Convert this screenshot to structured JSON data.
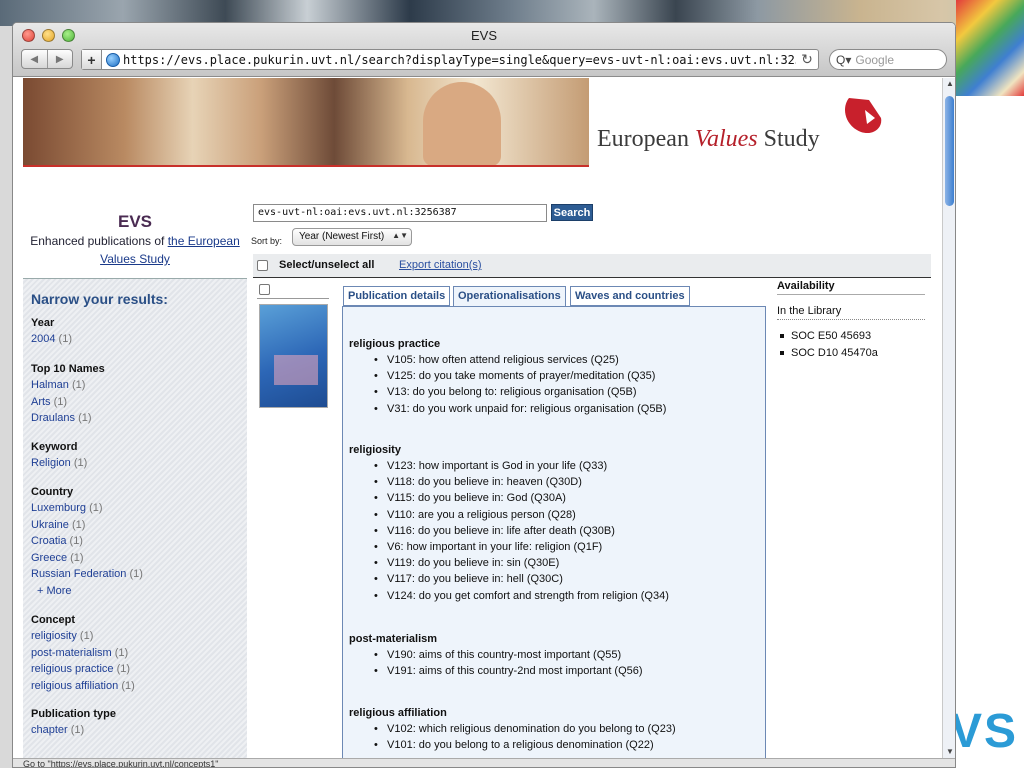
{
  "window": {
    "title": "EVS"
  },
  "toolbar": {
    "back_icon": "chevron-left",
    "forward_icon": "chevron-right",
    "add_icon": "plus",
    "url": "https://evs.place.pukurin.uvt.nl/search?displayType=single&query=evs-uvt-nl:oai:evs.uvt.nl:3256387",
    "reload_icon": "reload",
    "search_placeholder": "Google"
  },
  "header": {
    "brand_part1": "European ",
    "brand_accent": "Values",
    "brand_part2": " Study"
  },
  "site": {
    "title": "EVS",
    "subtitle_prefix": "Enhanced publications of ",
    "subtitle_link": "the European Values Study"
  },
  "search": {
    "query": "evs-uvt-nl:oai:evs.uvt.nl:3256387",
    "button": "Search",
    "sort_label": "Sort by:",
    "sort_value": "Year (Newest First)",
    "select_all": "Select/unselect all",
    "export": "Export citation(s)"
  },
  "sidebar": {
    "title": "Narrow your results:",
    "facets": [
      {
        "heading": "Year",
        "items": [
          {
            "label": "2004",
            "count": "(1)"
          }
        ]
      },
      {
        "heading": "Top 10 Names",
        "items": [
          {
            "label": "Halman",
            "count": "(1)"
          },
          {
            "label": "Arts",
            "count": "(1)"
          },
          {
            "label": "Draulans",
            "count": "(1)"
          }
        ]
      },
      {
        "heading": "Keyword",
        "items": [
          {
            "label": "Religion",
            "count": "(1)"
          }
        ]
      },
      {
        "heading": "Country",
        "items": [
          {
            "label": "Luxemburg",
            "count": "(1)"
          },
          {
            "label": "Ukraine",
            "count": "(1)"
          },
          {
            "label": "Croatia",
            "count": "(1)"
          },
          {
            "label": "Greece",
            "count": "(1)"
          },
          {
            "label": "Russian Federation",
            "count": "(1)"
          }
        ],
        "more": "+ More"
      },
      {
        "heading": "Concept",
        "items": [
          {
            "label": "religiosity",
            "count": "(1)"
          },
          {
            "label": "post-materialism",
            "count": "(1)"
          },
          {
            "label": "religious practice",
            "count": "(1)"
          },
          {
            "label": "religious affiliation",
            "count": "(1)"
          }
        ]
      },
      {
        "heading": "Publication type",
        "items": [
          {
            "label": "chapter",
            "count": "(1)"
          }
        ]
      }
    ]
  },
  "result": {
    "tabs": [
      "Publication details",
      "Operationalisations",
      "Waves and countries"
    ],
    "active_tab": "Operationalisations",
    "groups": [
      {
        "heading": "religious practice",
        "items": [
          "V105: how often attend religious services (Q25)",
          "V125: do you take moments of prayer/meditation (Q35)",
          "V13: do you belong to: religious organisation (Q5B)",
          "V31: do you work unpaid for: religious organisation (Q5B)"
        ]
      },
      {
        "heading": "religiosity",
        "items": [
          "V123: how important is God in your life (Q33)",
          "V118: do you believe in: heaven (Q30D)",
          "V115: do you believe in: God (Q30A)",
          "V110: are you a religious person (Q28)",
          "V116: do you believe in: life after death (Q30B)",
          "V6: how important in your life: religion (Q1F)",
          "V119: do you believe in: sin (Q30E)",
          "V117: do you believe in: hell (Q30C)",
          "V124: do you get comfort and strength from religion (Q34)"
        ]
      },
      {
        "heading": "post-materialism",
        "items": [
          "V190: aims of this country-most important (Q55)",
          "V191: aims of this country-2nd most important (Q56)"
        ]
      },
      {
        "heading": "religious affiliation",
        "items": [
          "V102: which religious denomination do you belong to (Q23)",
          "V101: do you belong to a religious denomination (Q22)"
        ]
      }
    ]
  },
  "availability": {
    "heading": "Availability",
    "subheading": "In the Library",
    "items": [
      "SOC E50 45693",
      "SOC D10 45470a"
    ]
  },
  "statusbar": {
    "text": "Go to \"https://evs.place.pukurin.uvt.nl/concepts1\""
  },
  "desktop": {
    "logo_text": "VS"
  },
  "colors": {
    "accent": "#2a4f86",
    "brand_red": "#b5202a",
    "search_button": "#2d5c93"
  }
}
